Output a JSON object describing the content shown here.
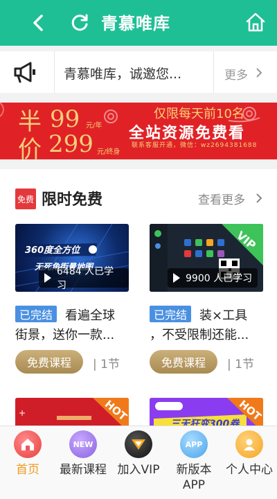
{
  "header": {
    "title": "青慕唯库",
    "back_icon": "chevron-left-icon",
    "refresh_icon": "refresh-icon",
    "home_icon": "home-icon",
    "color": "#1fbf95"
  },
  "notice": {
    "text": "青慕唯库，诚邀您...",
    "more": "更多"
  },
  "banner": {
    "half": "半",
    "price_year": "99",
    "per_year": "元/年",
    "price_word": "价",
    "price_life": "299",
    "lifetime": "元/终身",
    "limit": "仅限每天前10名",
    "slogan": "全站资源免费看",
    "contact": "联系客服开通，微信：wz2694381688",
    "color": "#e02227"
  },
  "section": {
    "badge": "免费",
    "title": "限时免费",
    "see_more": "查看更多"
  },
  "cards": [
    {
      "thumb_text1": "360度全方位",
      "thumb_text2": "无死角街景地图",
      "views": "6484 人已学习",
      "status": "已完结",
      "title_line1": "看遍全球",
      "title_line2": "街景，送你一款...",
      "free_label": "免费课程",
      "lessons": "| 1节"
    },
    {
      "ribbon": "VIP",
      "views": "9900 人已学习",
      "status": "已完结",
      "title_line1": "装×工具",
      "title_line2": "，不受限制还能...",
      "free_label": "免费课程",
      "lessons": "| 1节"
    }
  ],
  "hot_cards": [
    {
      "ribbon": "HOT"
    },
    {
      "ribbon": "HOT",
      "thumb_text": "三天狂变300券"
    }
  ],
  "bottom_nav": [
    {
      "label": "首页",
      "icon": "home-icon",
      "active": true,
      "color": "#f05a5a"
    },
    {
      "label": "最新课程",
      "icon": "new-icon",
      "badge": "NEW",
      "color": "#9b7be8"
    },
    {
      "label": "加入VIP",
      "icon": "vip-icon",
      "color": "#2b2b2b"
    },
    {
      "label": "新版本\nAPP",
      "label1": "新版本",
      "label2": "APP",
      "icon": "app-icon",
      "badge": "APP",
      "color": "#5ab0f0"
    },
    {
      "label": "个人中心",
      "icon": "user-icon",
      "color": "#f5a623"
    }
  ]
}
